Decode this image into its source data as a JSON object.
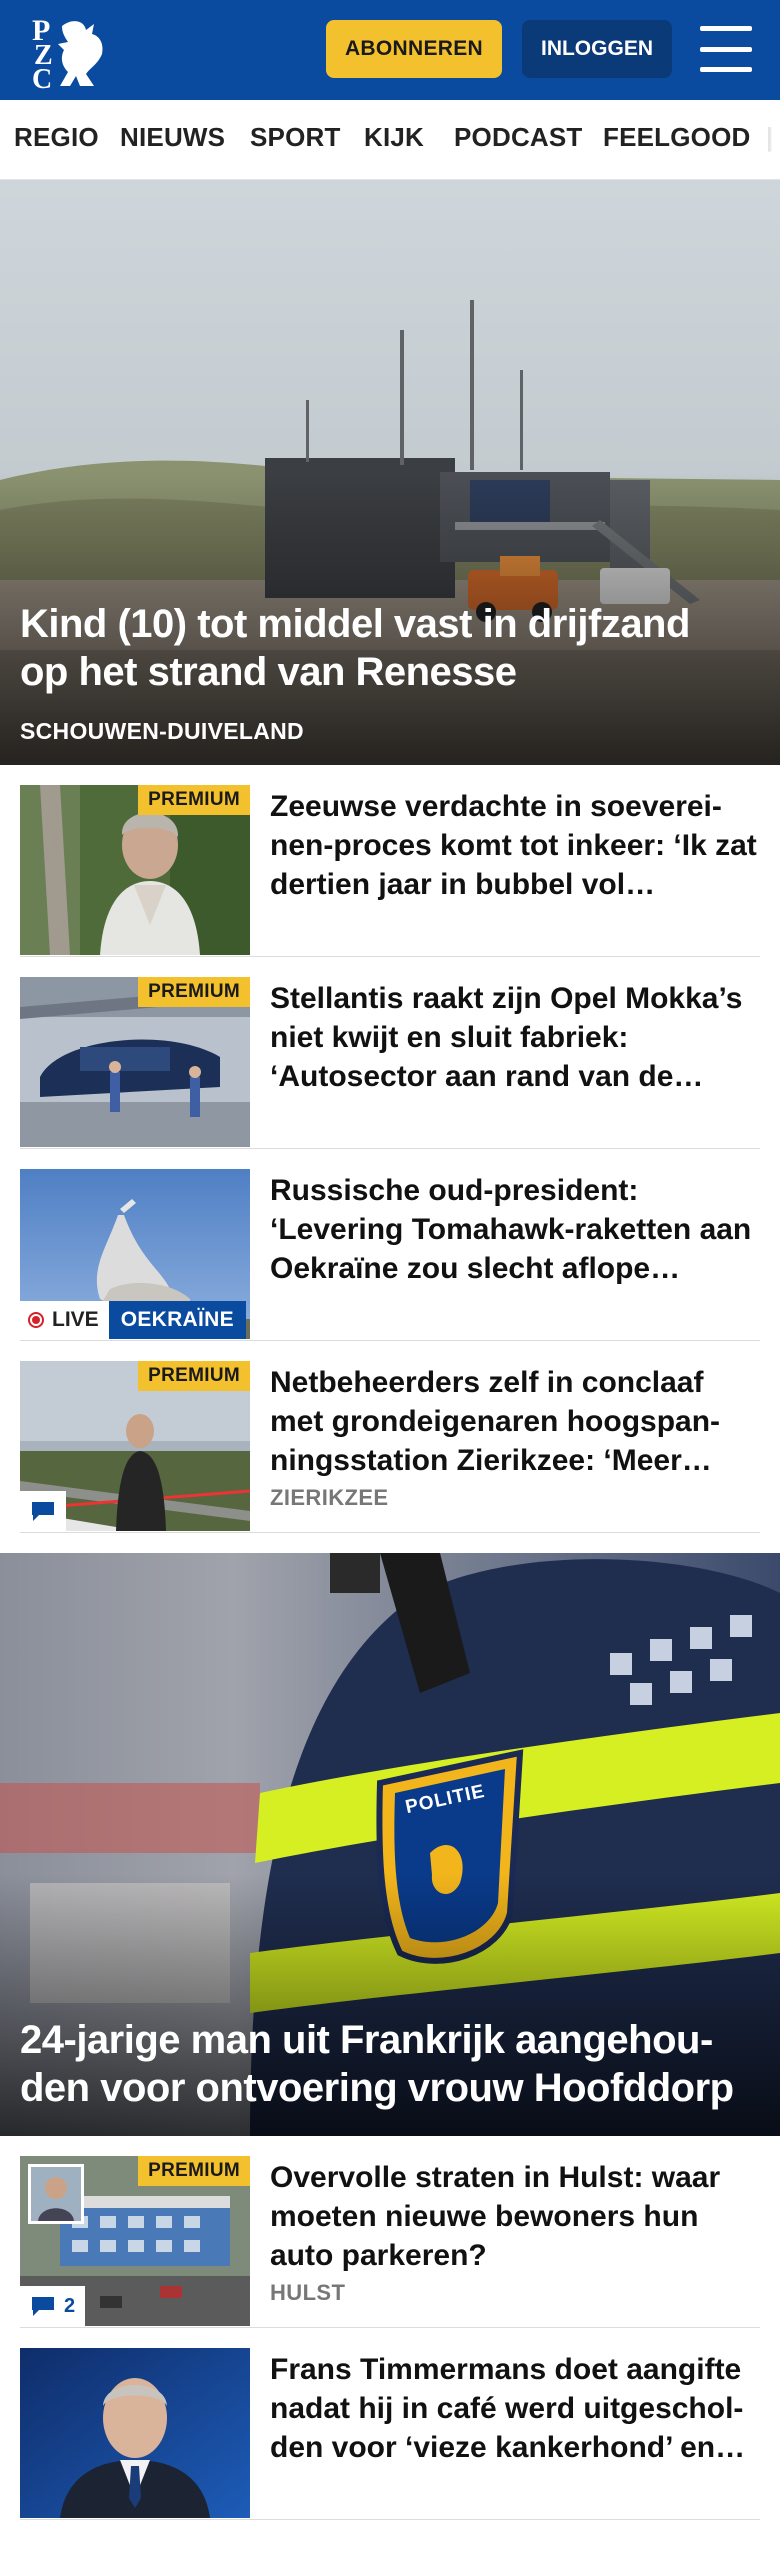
{
  "header": {
    "logo_text": "PZC",
    "subscribe_label": "ABONNEREN",
    "login_label": "INLOGGEN"
  },
  "nav": {
    "items": [
      "REGIO",
      "NIEUWS",
      "SPORT",
      "KIJK",
      "PODCAST",
      "FEELGOOD"
    ]
  },
  "hero1": {
    "title_line1": "Kind (10) tot middel vast in drijfzand",
    "title_line2": "op het strand van Renesse",
    "tag": "SCHOUWEN-DUIVELAND"
  },
  "articles": [
    {
      "premium": "PREMIUM",
      "title": "Zeeuwse verdachte in soeverei-nen-proces komt tot inkeer: ‘Ik zat dertien jaar in bubbel vol…"
    },
    {
      "premium": "PREMIUM",
      "title": "Stellantis raakt zijn Opel Mokka’s niet kwijt en sluit fabriek: ‘Autosector aan rand van de…"
    },
    {
      "live": "LIVE",
      "topic": "OEKRAÏNE",
      "title": "Russische oud-president: ‘Levering Tomahawk-raketten aan Oekraïne zou slecht aflope…"
    },
    {
      "premium": "PREMIUM",
      "title": "Netbeheerders zelf in conclaaf met grondeigenaren hoogspan-ningsstation Zierikzee: ‘Meer…",
      "region": "ZIERIKZEE"
    }
  ],
  "hero2": {
    "title_line1": "24-jarige man uit Frankrijk aangehou-",
    "title_line2": "den voor ontvoering vrouw Hoofddorp",
    "badge_text": "POLITIE"
  },
  "articles2": [
    {
      "premium": "PREMIUM",
      "title": "Overvolle straten in Hulst: waar moeten nieuwe bewoners hun auto parkeren?",
      "region": "HULST",
      "comments": "2"
    },
    {
      "title": "Frans Timmermans doet aangifte nadat hij in café werd uitgeschol-den voor ‘vieze kankerhond’ en…"
    }
  ],
  "colors": {
    "brand_blue": "#0a4ba0",
    "premium_yellow": "#f4c12e",
    "live_red": "#d6202a"
  }
}
